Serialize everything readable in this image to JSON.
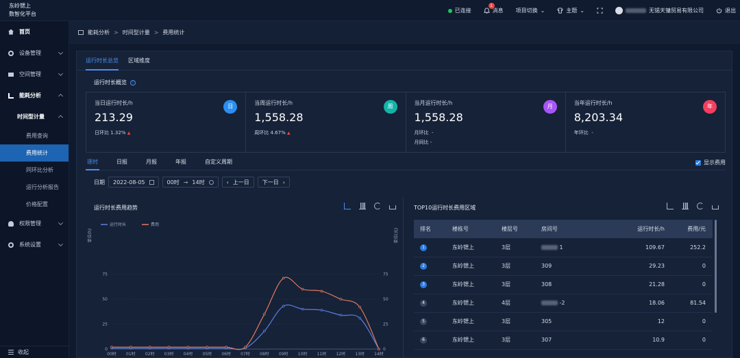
{
  "app": {
    "brand_line1": "东岭锶上",
    "brand_line2": "数智化平台"
  },
  "topbar": {
    "connected": "已连接",
    "messages": "消息",
    "message_badge": "1",
    "project_switch": "项目切换",
    "theme": "主题",
    "company": "无锡天镛贸易有限公司",
    "logout": "退出"
  },
  "sidebar": {
    "home": "首页",
    "device_mgmt": "设备管理",
    "space_mgmt": "空间管理",
    "energy_analysis": "能耗分析",
    "time_meter": "时间型计量",
    "sub_items": [
      "费用查询",
      "费用统计",
      "同环比分析",
      "运行分析报告",
      "价格配置"
    ],
    "permission_mgmt": "权限管理",
    "system_settings": "系统设置",
    "collapse": "收起"
  },
  "breadcrumb": {
    "l1": "能耗分析",
    "l2": "时间型计量",
    "l3": "费用统计"
  },
  "tabs_top": [
    "运行时长总览",
    "区域维度"
  ],
  "overview_title": "运行时长概览",
  "stats": [
    {
      "label": "当日运行时长/h",
      "value": "213.29",
      "sub1_label": "日环比",
      "sub1_value": "1.32%",
      "sub2": "",
      "badge": "日",
      "color": "#2b8ef0"
    },
    {
      "label": "当周运行时长/h",
      "value": "1,558.28",
      "sub1_label": "周环比",
      "sub1_value": "4.67%",
      "sub2": "",
      "badge": "周",
      "color": "#13b4a8"
    },
    {
      "label": "当月运行时长/h",
      "value": "1,558.28",
      "sub1_label": "月环比",
      "sub1_value": "-",
      "sub2": "月同比  -",
      "badge": "月",
      "color": "#a855f7"
    },
    {
      "label": "当年运行时长/h",
      "value": "8,203.34",
      "sub1_label": "年环比",
      "sub1_value": "-",
      "sub2": "",
      "badge": "年",
      "color": "#f43f5e"
    }
  ],
  "tabs_mid": [
    "逐时",
    "日报",
    "月报",
    "年报",
    "自定义周期"
  ],
  "show_fee": "显示费用",
  "filters": {
    "date_label": "日期",
    "date_value": "2022-08-05",
    "time_start": "00时",
    "time_end": "14时",
    "prev": "上一日",
    "next": "下一日"
  },
  "chart_card": {
    "title": "运行时长费用趋势"
  },
  "chart_data": {
    "type": "line",
    "title": "运行时长费用趋势",
    "x": [
      "00时",
      "01时",
      "02时",
      "03时",
      "04时",
      "05时",
      "06时",
      "07时",
      "08时",
      "09时",
      "10时",
      "11时",
      "12时",
      "13时",
      "14时"
    ],
    "series": [
      {
        "name": "运行时长",
        "color": "#5b7fe0",
        "values": [
          1,
          1,
          1,
          1,
          1,
          1,
          1,
          1,
          18,
          43,
          40,
          39,
          34,
          31,
          0
        ]
      },
      {
        "name": "费用",
        "color": "#e07a5f",
        "values": [
          2,
          2,
          2,
          2,
          2,
          2,
          2,
          2,
          35,
          71,
          60,
          58,
          50,
          42,
          0
        ]
      }
    ],
    "ylabel_left": "单位(h)",
    "ylabel_right": "单位(元)",
    "yticks": [
      0,
      25,
      50,
      75
    ],
    "ylim": [
      0,
      100
    ],
    "legend": "top-left"
  },
  "table_card": {
    "title": "TOP10运行时长费用区域",
    "headers": [
      "排名",
      "楼栋号",
      "楼层号",
      "房间号",
      "运行时长/h",
      "费用/元"
    ],
    "rows": [
      {
        "rank": "1",
        "building": "东岭锶上",
        "floor": "3层",
        "room": "1",
        "hours": "109.67",
        "fee": "252.2"
      },
      {
        "rank": "2",
        "building": "东岭锶上",
        "floor": "3层",
        "room": "309",
        "hours": "29.23",
        "fee": "0"
      },
      {
        "rank": "3",
        "building": "东岭锶上",
        "floor": "3层",
        "room": "308",
        "hours": "21.28",
        "fee": "0"
      },
      {
        "rank": "4",
        "building": "东岭锶上",
        "floor": "4层",
        "room": "-2",
        "hours": "18.06",
        "fee": "81.54"
      },
      {
        "rank": "5",
        "building": "东岭锶上",
        "floor": "3层",
        "room": "305",
        "hours": "12",
        "fee": "0"
      },
      {
        "rank": "6",
        "building": "东岭锶上",
        "floor": "3层",
        "room": "307",
        "hours": "10.9",
        "fee": "0"
      }
    ]
  }
}
